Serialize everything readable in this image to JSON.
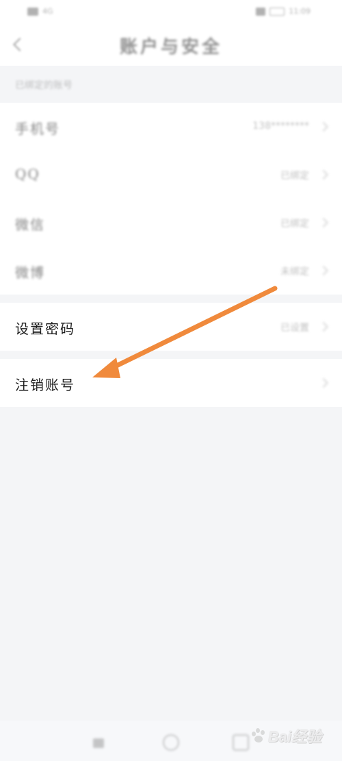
{
  "status_bar": {
    "left_text": "4G",
    "right_text": "11:09"
  },
  "header": {
    "title": "账户与安全"
  },
  "section": {
    "label": "已绑定的账号"
  },
  "bindings": [
    {
      "label": "手机号",
      "value": "138********"
    },
    {
      "label": "QQ",
      "value": "已绑定"
    },
    {
      "label": "微信",
      "value": "已绑定"
    },
    {
      "label": "微博",
      "value": "未绑定"
    }
  ],
  "password_row": {
    "label": "设置密码",
    "value": "已设置"
  },
  "cancel_row": {
    "label": "注销账号"
  },
  "watermark": {
    "text": "Bai经验"
  },
  "colors": {
    "arrow": "#f08a3c",
    "background": "#f4f5f7",
    "card": "#ffffff"
  }
}
